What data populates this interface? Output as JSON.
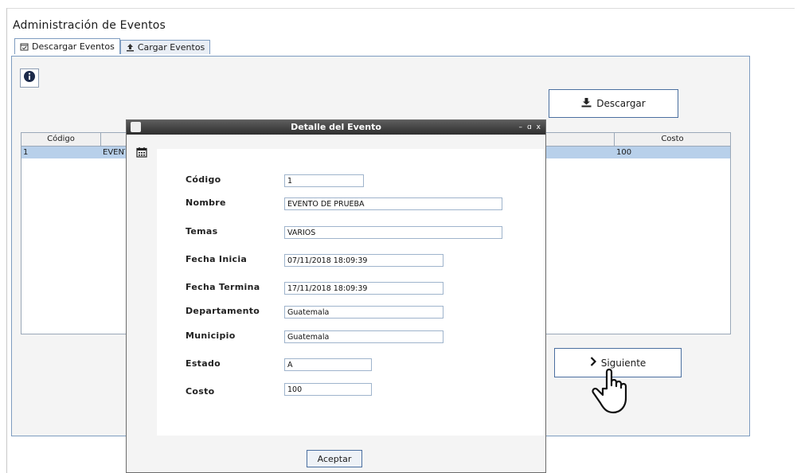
{
  "window": {
    "title": "Administración de Eventos"
  },
  "tabs": [
    {
      "label": "Descargar Eventos",
      "icon": "calendar-check-icon",
      "active": true
    },
    {
      "label": "Cargar Eventos",
      "icon": "upload-icon",
      "active": false
    }
  ],
  "toolbar": {
    "info_icon": "info-icon",
    "download_label": "Descargar",
    "next_label": "Siguiente"
  },
  "table": {
    "columns": [
      "Código",
      "Costo"
    ],
    "rows": [
      {
        "codigo": "1",
        "nombre": "EVENT",
        "costo": "100",
        "selected": true
      }
    ]
  },
  "dialog": {
    "title": "Detalle del Evento",
    "controls": [
      "–",
      "ɑ",
      "x"
    ],
    "fields": [
      {
        "label": "Código",
        "value": "1"
      },
      {
        "label": "Nombre",
        "value": "EVENTO DE PRUEBA"
      },
      {
        "label": "Temas",
        "value": "VARIOS"
      },
      {
        "label": "Fecha Inicia",
        "value": "07/11/2018 18:09:39"
      },
      {
        "label": "Fecha Termina",
        "value": "17/11/2018 18:09:39"
      },
      {
        "label": "Departamento",
        "value": "Guatemala"
      },
      {
        "label": "Municipio",
        "value": "Guatemala"
      },
      {
        "label": "Estado",
        "value": "A"
      },
      {
        "label": "Costo",
        "value": "100"
      }
    ],
    "ok_label": "Aceptar"
  },
  "colors": {
    "accent_border": "#4b6fa0",
    "selection": "#b8d0ea",
    "titlebar": "#3a3a3a"
  }
}
